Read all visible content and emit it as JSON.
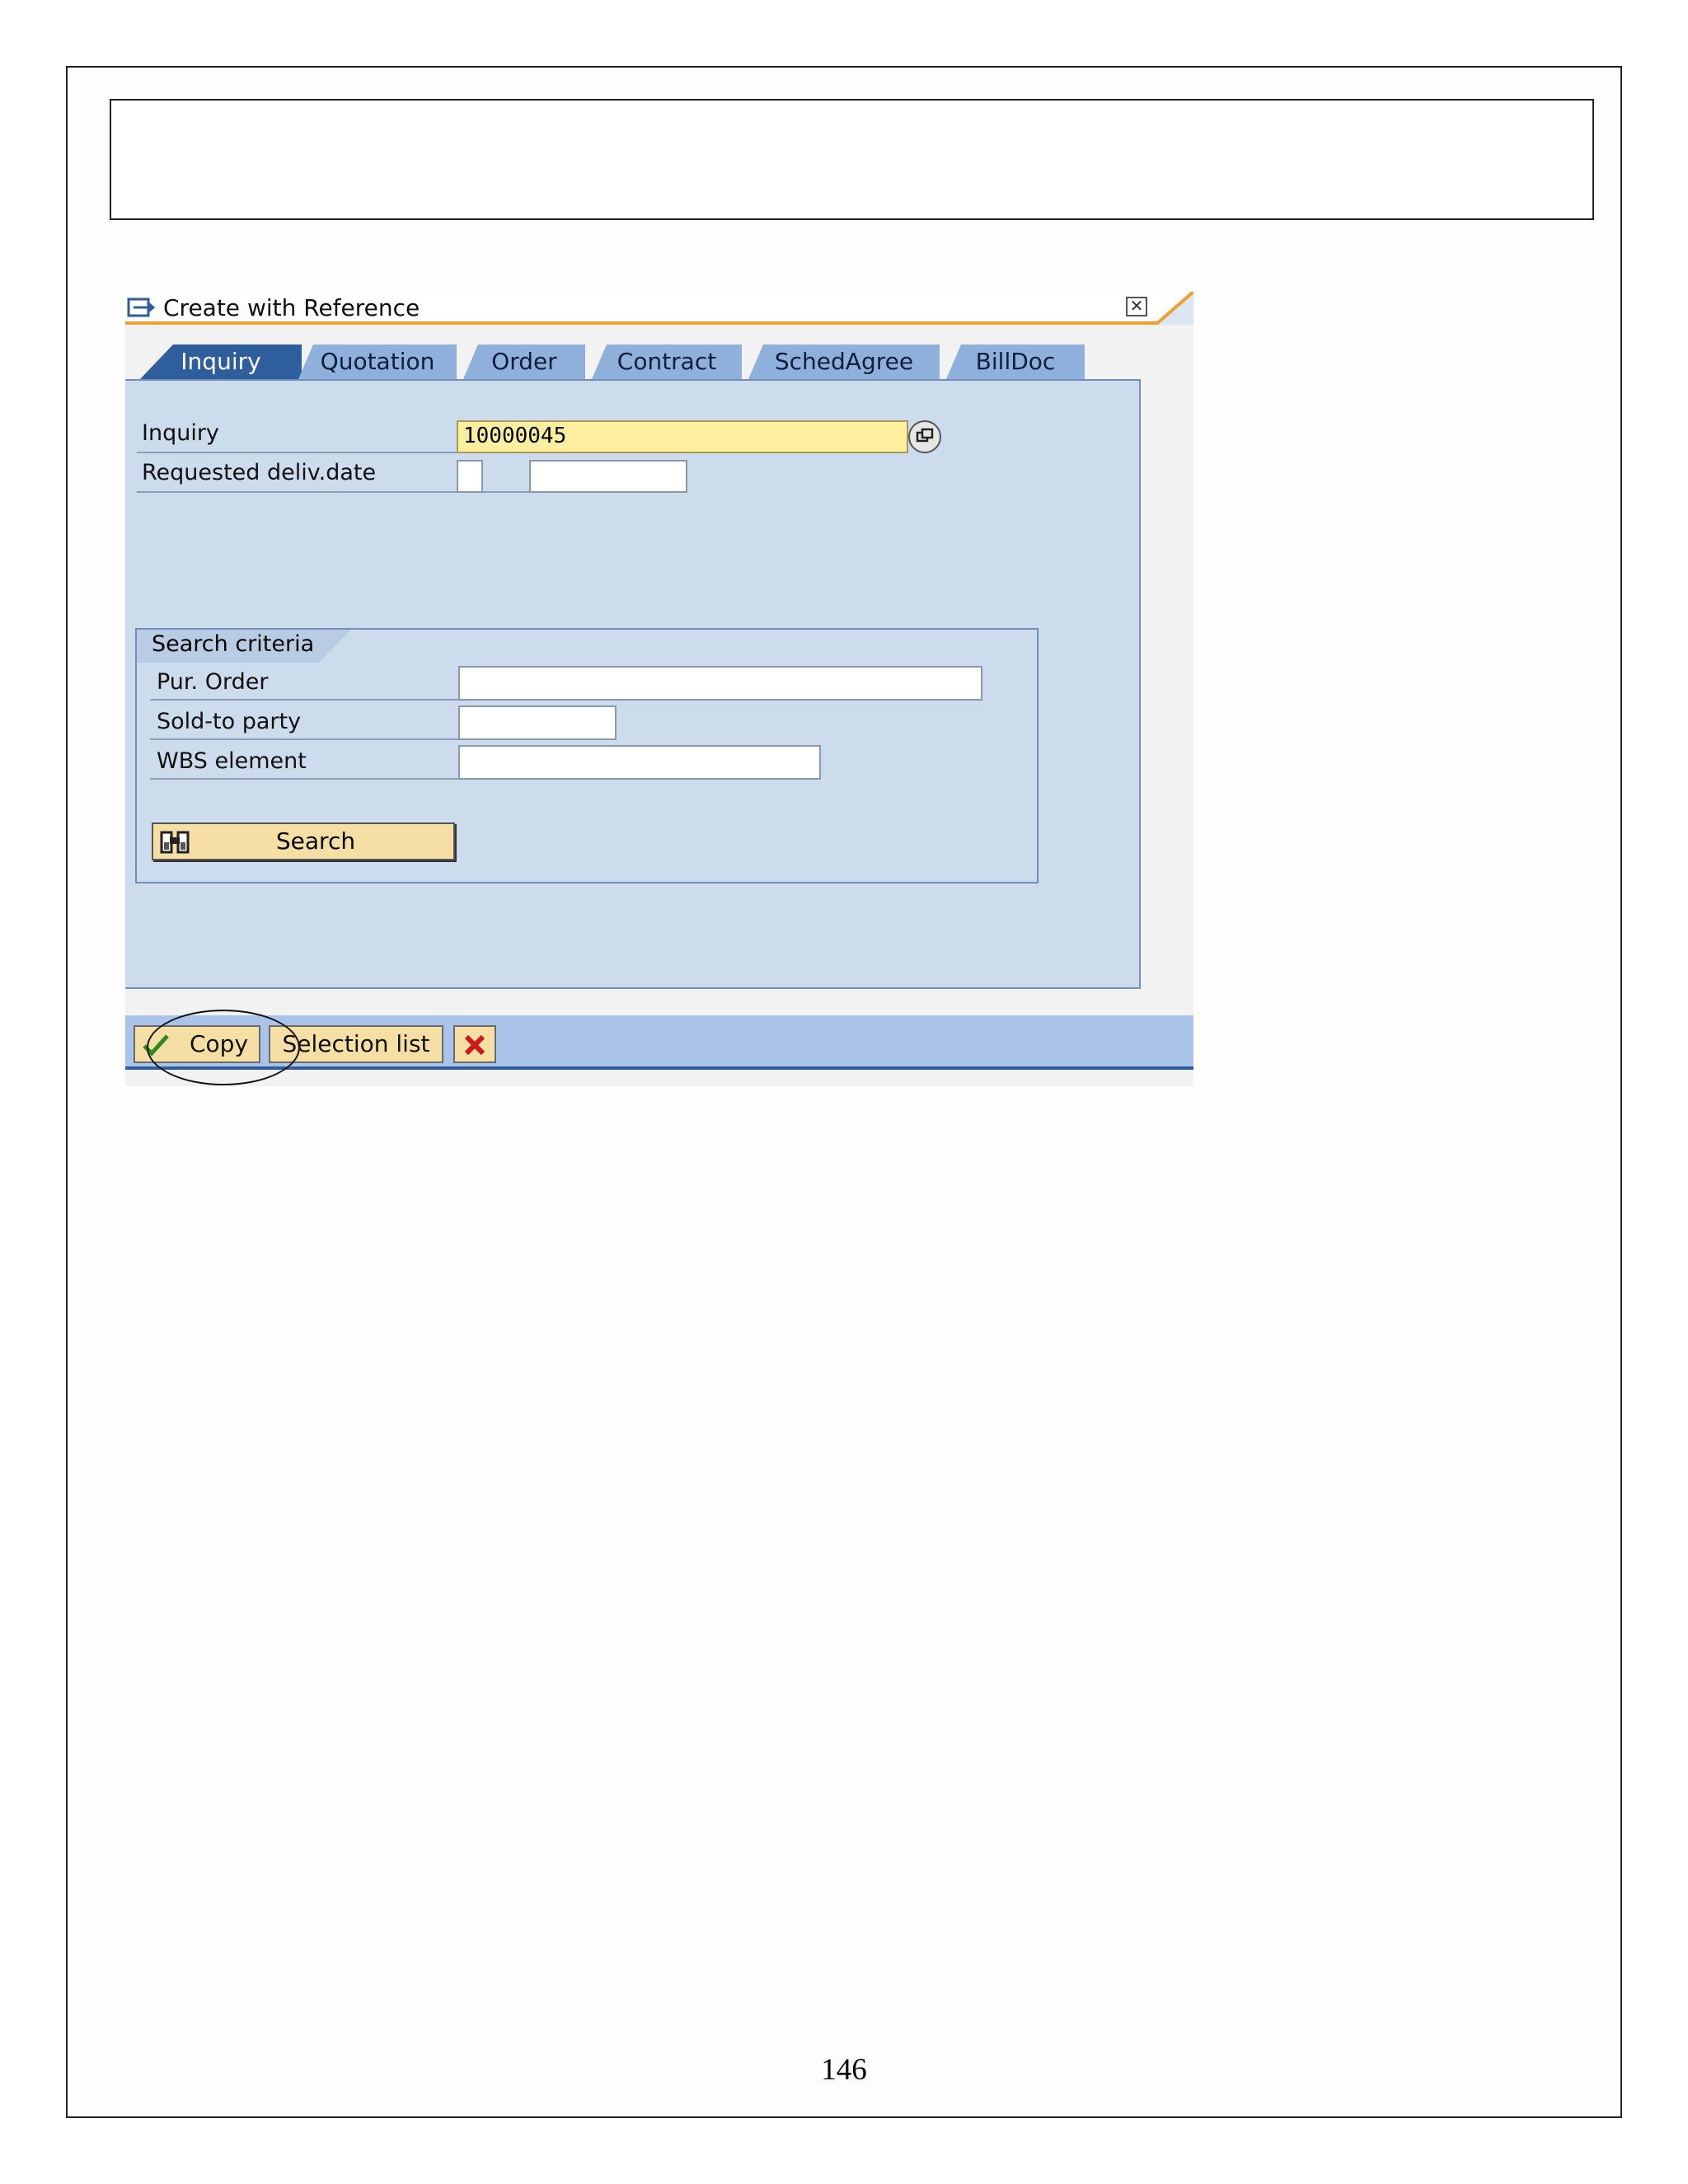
{
  "dialog": {
    "title": "Create with Reference",
    "close_glyph": "✕",
    "tabs": [
      "Inquiry",
      "Quotation",
      "Order",
      "Contract",
      "SchedAgree",
      "BillDoc"
    ],
    "active_tab": "Inquiry",
    "fields": {
      "inquiry_label": "Inquiry",
      "inquiry_value": "10000045",
      "req_date_label": "Requested deliv.date"
    },
    "search_criteria": {
      "title": "Search criteria",
      "pur_order_label": "Pur. Order",
      "sold_to_label": "Sold-to party",
      "wbs_label": "WBS element",
      "search_button": "Search"
    },
    "buttons": {
      "copy": "Copy",
      "selection_list": "Selection list"
    }
  },
  "page_number": "146",
  "colors": {
    "tab_active": "#2e5e9c",
    "tab_inactive": "#8fb0da",
    "panel": "#cddcec",
    "button": "#f6dfa4",
    "required_field": "#fdeea0",
    "title_underline": "#f0a030"
  }
}
